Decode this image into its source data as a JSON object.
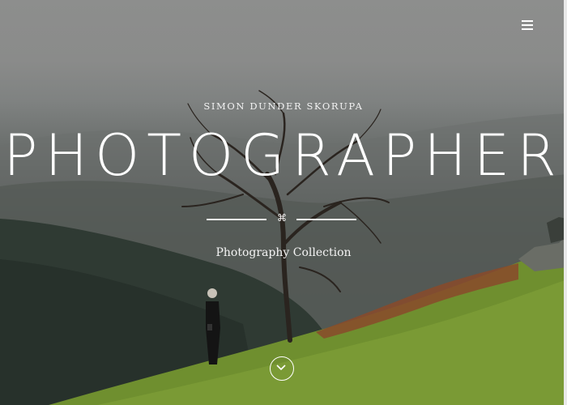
{
  "hero": {
    "eyebrow": "SIMON DUNDER SKORUPA",
    "title": "PHOTOGRAPHER",
    "divider_glyph": "⌘",
    "subtitle": "Photography Collection"
  },
  "icons": {
    "menu": "hamburger-menu-icon",
    "scroll": "chevron-down-icon"
  },
  "colors": {
    "text": "#ffffff",
    "grass": "#6f8f2f",
    "fern": "#8a4a2a",
    "sky": "#8d8e8d"
  }
}
